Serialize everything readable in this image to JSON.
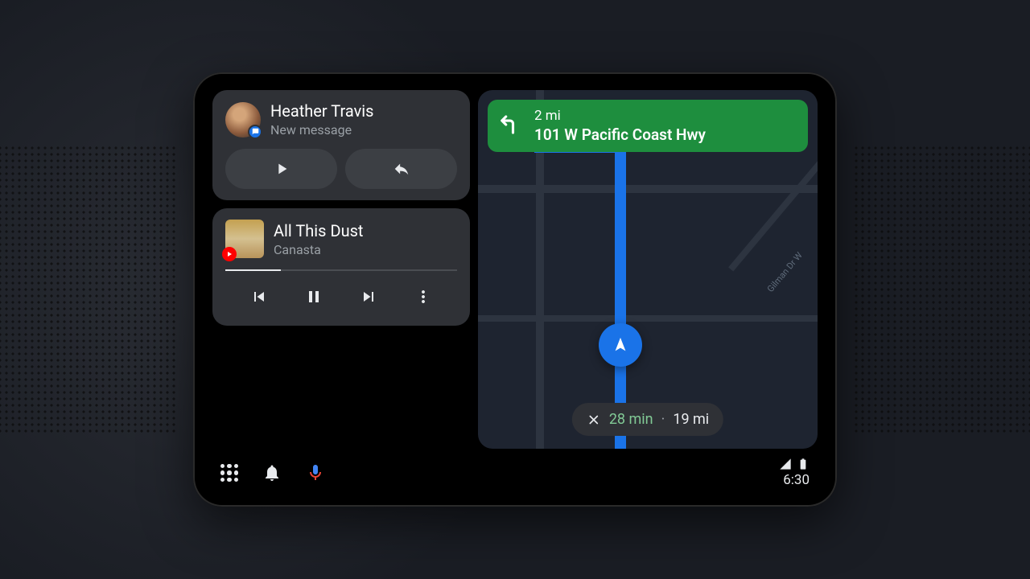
{
  "message": {
    "sender": "Heather Travis",
    "subtitle": "New message"
  },
  "music": {
    "title": "All This Dust",
    "artist": "Canasta"
  },
  "navigation": {
    "distance": "2 mi",
    "road_name": "101 W Pacific Coast Hwy",
    "cross_street": "Gilman Dr W",
    "eta_time": "28 min",
    "eta_distance": "19 mi"
  },
  "status": {
    "time": "6:30"
  }
}
